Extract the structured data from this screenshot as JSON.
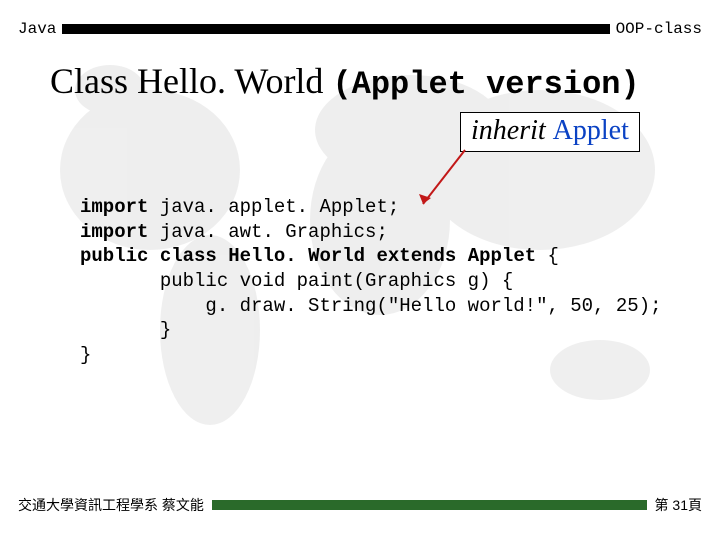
{
  "header": {
    "left": "Java",
    "right": "OOP-class"
  },
  "title": {
    "plain": "Class  Hello. World ",
    "mono": "(Applet version)"
  },
  "inherit": {
    "italic": "inherit ",
    "applet": "Applet"
  },
  "code": {
    "l1a": "import",
    "l1b": " java. applet. Applet;",
    "l2a": "import",
    "l2b": " java. awt. Graphics;",
    "l3a": "public",
    "l3b": " ",
    "l3c": "class",
    "l3d": " ",
    "l3e": "Hello. World",
    "l3f": " ",
    "l3g": "extends",
    "l3h": " ",
    "l3i": "Applet",
    "l3j": " {",
    "l4": "       public void paint(Graphics g) {",
    "l5": "           g. draw. String(\"Hello world!\", 50, 25);",
    "l6": "       }",
    "l7": "}"
  },
  "footer": {
    "left": "交通大學資訊工程學系 蔡文能",
    "right": "第 31頁"
  }
}
